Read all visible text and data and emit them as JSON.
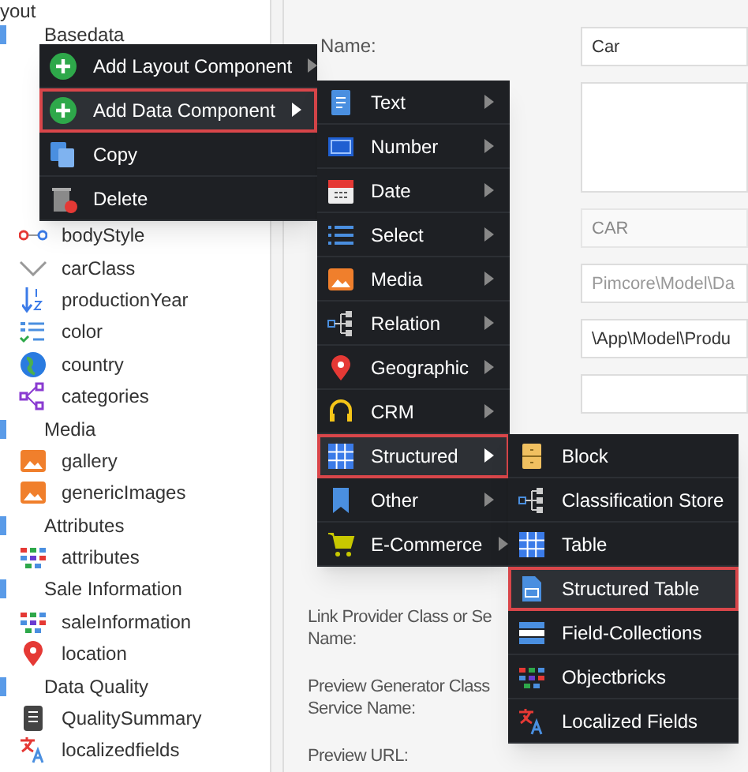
{
  "tree": [
    {
      "label": "yout",
      "kind": "group"
    },
    {
      "label": "Basedata",
      "kind": "group"
    },
    {
      "label": "bodyStyle",
      "kind": "relation"
    },
    {
      "label": "carClass",
      "kind": "select"
    },
    {
      "label": "productionYear",
      "kind": "numeric"
    },
    {
      "label": "color",
      "kind": "multiselect"
    },
    {
      "label": "country",
      "kind": "country"
    },
    {
      "label": "categories",
      "kind": "manyrelation"
    },
    {
      "label": "Media",
      "kind": "group"
    },
    {
      "label": "gallery",
      "kind": "image"
    },
    {
      "label": "genericImages",
      "kind": "image"
    },
    {
      "label": "Attributes",
      "kind": "group"
    },
    {
      "label": "attributes",
      "kind": "bricks"
    },
    {
      "label": "Sale Information",
      "kind": "group"
    },
    {
      "label": "saleInformation",
      "kind": "bricks"
    },
    {
      "label": "location",
      "kind": "geo"
    },
    {
      "label": "Data Quality",
      "kind": "group"
    },
    {
      "label": "QualitySummary",
      "kind": "summary"
    },
    {
      "label": "localizedfields",
      "kind": "localized"
    }
  ],
  "form": {
    "fields": [
      {
        "label": "Name:",
        "value": "Car",
        "kind": "input",
        "disabled": false
      },
      {
        "kind": "textarea"
      },
      {
        "value": "CAR",
        "kind": "input",
        "disabled": true
      },
      {
        "placeholder": "Pimcore\\Model\\Da",
        "kind": "input"
      },
      {
        "value": "\\App\\Model\\Produ",
        "kind": "input",
        "disabled": false
      },
      {
        "kind": "input"
      }
    ],
    "labels": [
      {
        "lines": [
          "Link Provider Class or Se",
          "Name:"
        ]
      },
      {
        "lines": [
          "Preview Generator Class",
          "Service Name:"
        ]
      },
      {
        "lines": [
          "Preview URL:"
        ]
      }
    ]
  },
  "context_menu": [
    {
      "label": "Add Layout Component",
      "kind": "add",
      "submenu": true,
      "selected": false
    },
    {
      "label": "Add Data Component",
      "kind": "add",
      "submenu": true,
      "selected": true
    },
    {
      "label": "Copy",
      "kind": "copy",
      "submenu": false,
      "selected": false
    },
    {
      "label": "Delete",
      "kind": "delete",
      "submenu": false,
      "selected": false
    }
  ],
  "data_menu": [
    {
      "label": "Text",
      "kind": "text",
      "selected": false
    },
    {
      "label": "Number",
      "kind": "number",
      "selected": false
    },
    {
      "label": "Date",
      "kind": "date",
      "selected": false
    },
    {
      "label": "Select",
      "kind": "select",
      "selected": false
    },
    {
      "label": "Media",
      "kind": "media",
      "selected": false
    },
    {
      "label": "Relation",
      "kind": "relation",
      "selected": false
    },
    {
      "label": "Geographic",
      "kind": "geo",
      "selected": false
    },
    {
      "label": "CRM",
      "kind": "crm",
      "selected": false
    },
    {
      "label": "Structured",
      "kind": "grid",
      "selected": true
    },
    {
      "label": "Other",
      "kind": "other",
      "selected": false
    },
    {
      "label": "E-Commerce",
      "kind": "cart",
      "selected": false
    }
  ],
  "structured_menu": [
    {
      "label": "Block",
      "kind": "block",
      "selected": false
    },
    {
      "label": "Classification Store",
      "kind": "relation",
      "selected": false
    },
    {
      "label": "Table",
      "kind": "grid",
      "selected": false
    },
    {
      "label": "Structured Table",
      "kind": "sheet",
      "selected": true
    },
    {
      "label": "Field-Collections",
      "kind": "collections",
      "selected": false
    },
    {
      "label": "Objectbricks",
      "kind": "bricks",
      "selected": false
    },
    {
      "label": "Localized Fields",
      "kind": "localized",
      "selected": false
    }
  ]
}
